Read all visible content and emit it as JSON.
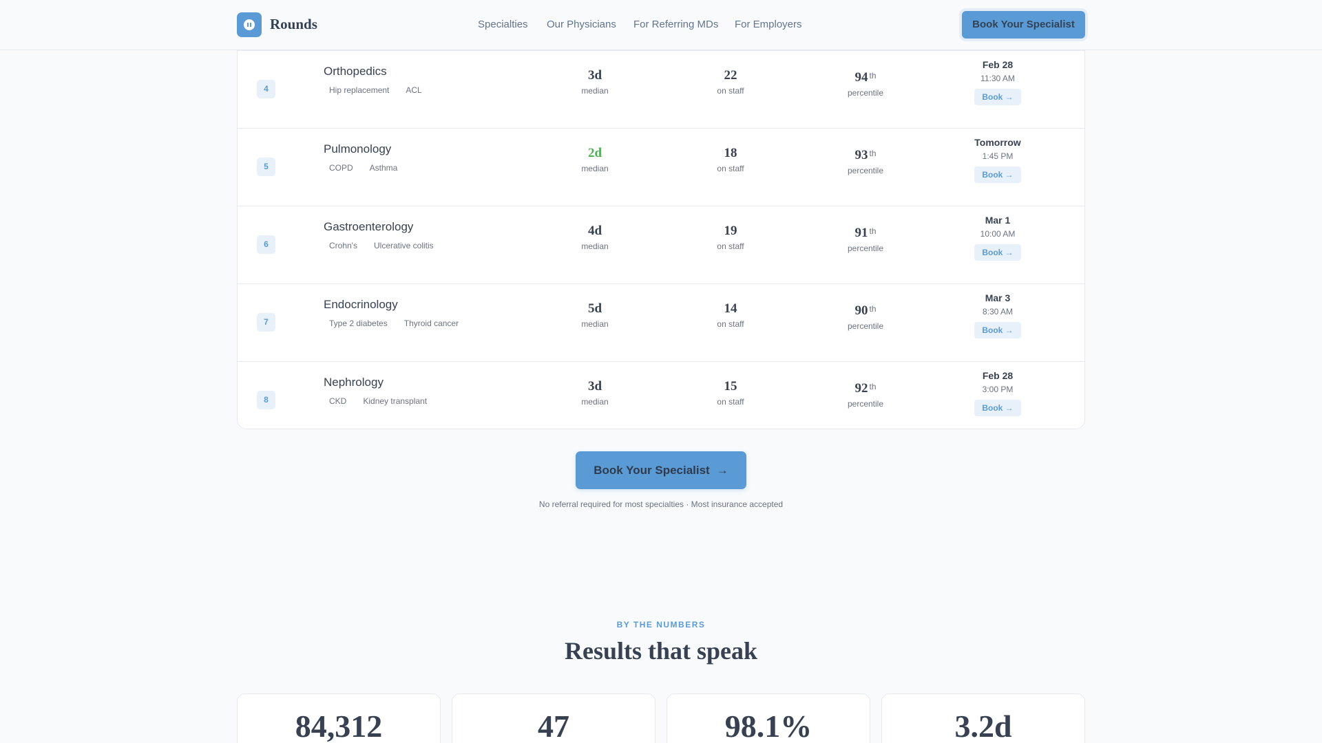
{
  "header": {
    "brand": "Rounds",
    "nav": [
      "Specialties",
      "Our Physicians",
      "For Referring MDs",
      "For Employers"
    ],
    "cta_label": "Book Your Specialist"
  },
  "rows": [
    {
      "rank": "4",
      "name": "Orthopedics",
      "tags": [
        "Hip replacement",
        "ACL"
      ],
      "wait": "3d",
      "wait_label": "median",
      "staff": "22",
      "staff_label": "on staff",
      "pct": "94",
      "pct_suffix": "th",
      "pct_label": "percentile",
      "date": "Feb 28",
      "time": "11:30 AM",
      "book": "Book →"
    },
    {
      "rank": "5",
      "name": "Pulmonology",
      "tags": [
        "COPD",
        "Asthma"
      ],
      "wait": "2d",
      "wait_label": "median",
      "staff": "18",
      "staff_label": "on staff",
      "pct": "93",
      "pct_suffix": "th",
      "pct_label": "percentile",
      "date": "Tomorrow",
      "time": "1:45 PM",
      "book": "Book →"
    },
    {
      "rank": "6",
      "name": "Gastroenterology",
      "tags": [
        "Crohn's",
        "Ulcerative colitis"
      ],
      "wait": "4d",
      "wait_label": "median",
      "staff": "19",
      "staff_label": "on staff",
      "pct": "91",
      "pct_suffix": "th",
      "pct_label": "percentile",
      "date": "Mar 1",
      "time": "10:00 AM",
      "book": "Book →"
    },
    {
      "rank": "7",
      "name": "Endocrinology",
      "tags": [
        "Type 2 diabetes",
        "Thyroid cancer"
      ],
      "wait": "5d",
      "wait_label": "median",
      "staff": "14",
      "staff_label": "on staff",
      "pct": "90",
      "pct_suffix": "th",
      "pct_label": "percentile",
      "date": "Mar 3",
      "time": "8:30 AM",
      "book": "Book →"
    },
    {
      "rank": "8",
      "name": "Nephrology",
      "tags": [
        "CKD",
        "Kidney transplant"
      ],
      "wait": "3d",
      "wait_label": "median",
      "staff": "15",
      "staff_label": "on staff",
      "pct": "92",
      "pct_suffix": "th",
      "pct_label": "percentile",
      "date": "Feb 28",
      "time": "3:00 PM",
      "book": "Book →"
    }
  ],
  "cta": {
    "label": "Book Your Specialist",
    "note": "No referral required for most specialties · Most insurance accepted"
  },
  "numbers": {
    "eyebrow": "BY THE NUMBERS",
    "title": "Results that speak",
    "stats": [
      "84,312",
      "47",
      "98.1%",
      "3.2d"
    ]
  },
  "colors": {
    "accent": "#5b9bd5",
    "accent_light": "#e8f1fa",
    "highlight_green": "#4caf50",
    "text": "#374151",
    "muted": "#6b7280"
  }
}
